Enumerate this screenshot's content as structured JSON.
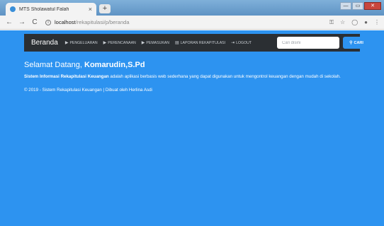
{
  "browser": {
    "tab_title": "MTS Sholawatul Falah",
    "tab_close": "×",
    "new_tab": "+",
    "window_min": "—",
    "window_max": "▭",
    "window_close": "✕",
    "back": "←",
    "forward": "→",
    "reload": "C",
    "url_host": "localhost",
    "url_path": "/rekapitulasi/p/beranda",
    "icon_key": "⚿",
    "icon_star": "☆",
    "icon_extension": "◯",
    "icon_profile": "●",
    "icon_menu": "⋮"
  },
  "navbar": {
    "brand": "Beranda",
    "items": [
      {
        "icon": "▶",
        "label": "PENGELUARAN"
      },
      {
        "icon": "▶",
        "label": "PERENCANAAN"
      },
      {
        "icon": "▶",
        "label": "PEMASUKAN"
      },
      {
        "icon": "▤",
        "label": "LAPORAN REKAPITULASI"
      },
      {
        "icon": "⇥",
        "label": "LOGOUT"
      }
    ],
    "search_placeholder": "Cari disini",
    "search_button": "CARI",
    "search_icon": "⚲"
  },
  "content": {
    "welcome_prefix": "Selamat Datang,",
    "welcome_name": "Komarudin,S.Pd",
    "desc_bold": "Sistem Informasi Rekapitulasi Keuangan",
    "desc_rest": " adalah aplikasi berbasis web sederhana yang dapat digunakan untuk mengontrol keuangan dengan mudah di sekolah.",
    "footer": "© 2019 - Sistem Rekapitulasi Keuangan | Dibuat oleh Herlina Asdi"
  },
  "colors": {
    "page_bg": "#2d93f0",
    "navbar_bg": "#2b2f33",
    "accent": "#2d93f0"
  }
}
